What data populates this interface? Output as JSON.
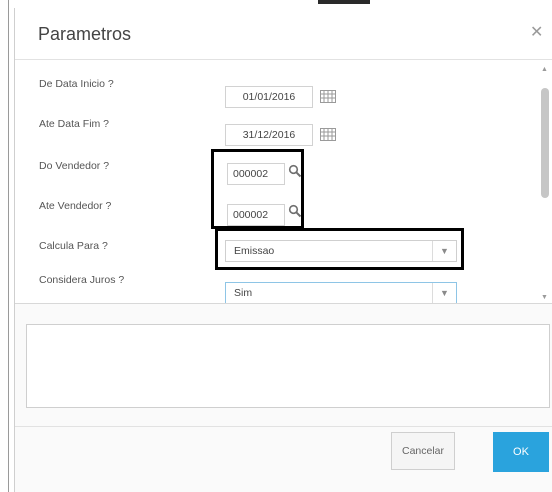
{
  "dialog": {
    "title": "Parametros",
    "close_icon": "close-icon"
  },
  "params": [
    {
      "label": "De Data Inicio ?",
      "value": "01/01/2016",
      "kind": "date",
      "icon": "calendar-icon"
    },
    {
      "label": "Ate Data Fim ?",
      "value": "31/12/2016",
      "kind": "date",
      "icon": "calendar-icon"
    },
    {
      "label": "Do Vendedor ?",
      "value": "000002",
      "kind": "lookup",
      "icon": "search-icon"
    },
    {
      "label": "Ate Vendedor ?",
      "value": "000002",
      "kind": "lookup",
      "icon": "search-icon"
    },
    {
      "label": "Calcula Para ?",
      "value": "Emissao",
      "kind": "select",
      "icon": "chevron-down-icon"
    },
    {
      "label": "Considera Juros ?",
      "value": "Sim",
      "kind": "select",
      "icon": "chevron-down-icon"
    }
  ],
  "buttons": {
    "cancel": "Cancelar",
    "ok": "OK"
  },
  "colors": {
    "primary_button": "#2aa3dd",
    "highlight": "#000000"
  }
}
